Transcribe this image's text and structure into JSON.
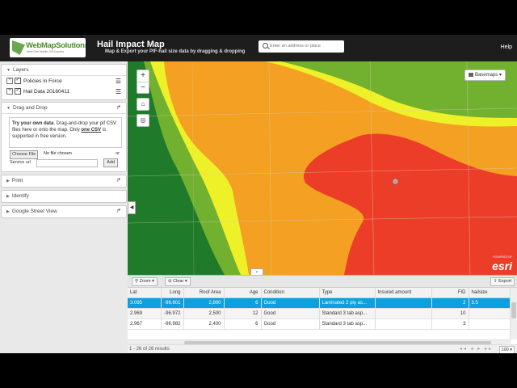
{
  "header": {
    "logo_text": "WebMapSolutions",
    "logo_tagline": "Next-Gen Mobile GIS Experts",
    "title": "Hail Impact Map",
    "subtitle": "Map & Export your PIF-hail size data by dragging & dropping",
    "search_placeholder": "Enter an address or place",
    "help_label": "Help"
  },
  "sidebar": {
    "layers_title": "Layers",
    "layers": [
      {
        "label": "Policies in Force",
        "checked": true
      },
      {
        "label": "Hail Data 20160411",
        "checked": true
      }
    ],
    "dragdrop_title": "Drag and Drop",
    "dragdrop_bold": "Try your own data",
    "dragdrop_text": ". Drag-and-drop your pif CSV files here or onto the map. Only ",
    "dragdrop_underline": "one CSV",
    "dragdrop_tail": " is supported in free version.",
    "choose_file": "Choose File",
    "no_file": "No file chosen",
    "or_label": "or",
    "service_url_label": "Service url",
    "add_label": "Add",
    "print_title": "Print",
    "identify_title": "Identify",
    "streetview_title": "Google Street View"
  },
  "map": {
    "basemaps_label": "Basemaps",
    "attribution_small": "POWERED BY",
    "attribution": "esri",
    "colors": {
      "dark_green": "#1f7a2a",
      "green": "#72b02f",
      "yellow": "#eef028",
      "orange": "#f4a023",
      "red": "#ec3d28"
    }
  },
  "table": {
    "zoom_label": "Zoom",
    "clear_label": "Clear",
    "export_label": "Export",
    "columns": [
      "Lat",
      "Long",
      "Roof Area",
      "Age",
      "Condition",
      "Type",
      "Insured amount",
      "FID",
      "hailsize"
    ],
    "rows": [
      [
        "3.095",
        "-96.601",
        "2,800",
        "6",
        "Good",
        "Laminated 2 ply as...",
        "",
        "2",
        "3.5"
      ],
      [
        "2.969",
        "-96.972",
        "2,500",
        "12",
        "Good",
        "Standard 3 tab asp...",
        "",
        "10",
        ""
      ],
      [
        "2.967",
        "-96.982",
        "2,400",
        "6",
        "Good",
        "Standard 3 tab asp...",
        "",
        "3",
        ""
      ]
    ],
    "results_text": "1 - 26 of 26 results",
    "pager_text": "◂◂ ◂ ▸ ▸▸",
    "page_size": "100"
  }
}
